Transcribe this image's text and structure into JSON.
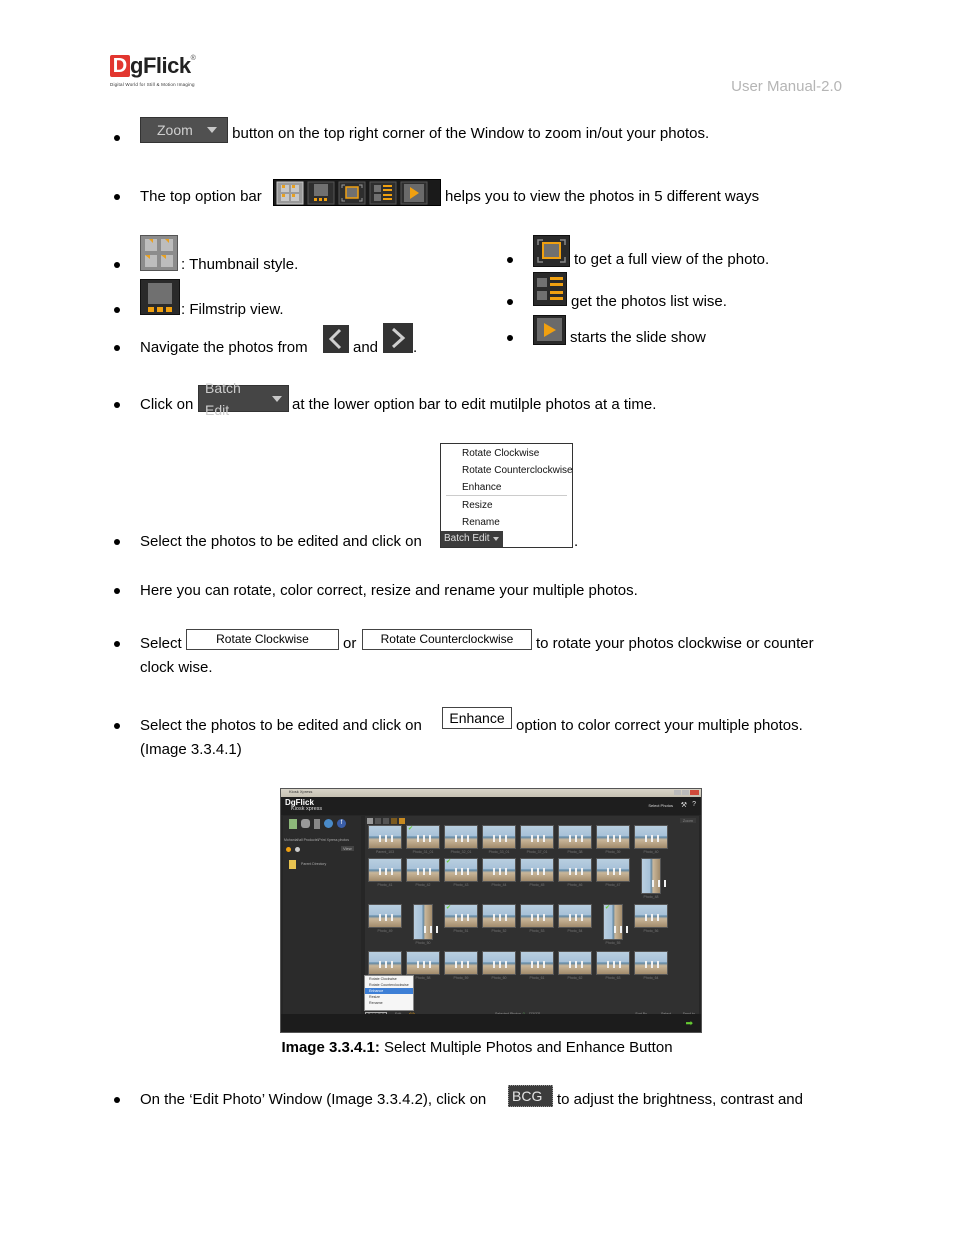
{
  "header": {
    "logo_letter": "D",
    "logo_text": "gFlick",
    "logo_registered": "®",
    "logo_tagline": "Digital World for Still & Motion Imaging",
    "doc_title": "User Manual-2.0"
  },
  "bullets": {
    "zoom": {
      "button_label": "Zoom",
      "text": "button on the top right corner of the Window to zoom in/out your photos."
    },
    "top_bar": {
      "prefix": "The top option bar",
      "suffix": "helps you to view the photos in 5 different ways"
    },
    "thumbnail": {
      "text": ": Thumbnail style."
    },
    "filmstrip": {
      "text": ": Filmstrip view."
    },
    "navigate": {
      "prefix": "Navigate the photos from",
      "middle": "and",
      "suffix": "."
    },
    "fullview": {
      "text": "to get a full view of the photo."
    },
    "listwise": {
      "text": "get the photos list wise."
    },
    "slideshow": {
      "text": "starts the slide show"
    },
    "batch_click": {
      "prefix": "Click on",
      "button_label": "Batch Edit",
      "suffix": "at the lower option bar to edit mutilple photos at a time."
    },
    "batch_select": {
      "prefix": "Select the photos to be edited and click on",
      "button_label": "Batch Edit",
      "suffix": "."
    },
    "batch_menu": [
      "Rotate Clockwise",
      "Rotate Counterclockwise",
      "Enhance",
      "Resize",
      "Rename"
    ],
    "here": {
      "text": "Here you can rotate, color correct, resize and rename your multiple photos."
    },
    "rotate": {
      "prefix": "Select",
      "btn1": "Rotate Clockwise",
      "middle": "or",
      "btn2": "Rotate Counterclockwise",
      "suffix": "to rotate your photos clockwise or counter",
      "line2": "clock wise."
    },
    "enhance": {
      "prefix": "Select the photos to be edited and click on",
      "button_label": "Enhance",
      "suffix": "option to color correct your multiple photos.",
      "line2": "(Image 3.3.4.1)"
    },
    "bcg": {
      "prefix": "On the ‘Edit Photo’ Window (Image 3.3.4.2), click on",
      "button_label": "BCG",
      "suffix": "to adjust the brightness, contrast and"
    }
  },
  "screenshot": {
    "window_title": "Kiosk Xpress",
    "app_brand": "DgFlick",
    "app_subtitle": "Kiosk xpress",
    "top_right_label": "Select Photos",
    "zoom_label": "Zoom",
    "path_text": "Mohanial\\all Products\\Print Xpress photos",
    "view_label": "View",
    "folder_label": "Parent Directory",
    "photo_labels": [
      [
        "Parent_103",
        "Photo_31_01",
        "Photo_32_01",
        "Photo_33_01",
        "Photo_37_01",
        "Photo_38",
        "Photo_39",
        "Photo_40"
      ],
      [
        "Photo_41",
        "Photo_42",
        "Photo_43",
        "Photo_44",
        "Photo_45",
        "Photo_46",
        "Photo_47",
        "Photo_48"
      ],
      [
        "Photo_49",
        "Photo_50",
        "Photo_51",
        "Photo_52",
        "Photo_53",
        "Photo_54",
        "Photo_55",
        "Photo_56"
      ],
      [
        "Photo_57",
        "Photo_58",
        "Photo_59",
        "Photo_60",
        "Photo_61",
        "Photo_62",
        "Photo_63",
        "Photo_64"
      ]
    ],
    "dropdown_items": [
      "Rotate Clockwise",
      "Rotate Counterclockwise",
      "Enhance",
      "Resize",
      "Rename"
    ],
    "dropdown_selected": "Enhance",
    "bottom": {
      "batch_edit": "Batch Edit",
      "edit": "Edit",
      "selected_label": "Selected Photos :",
      "selected_count": "1",
      "selected_total": "[23/32]",
      "sort_by": "Sort By",
      "select": "Select",
      "send_to": "Send to"
    }
  },
  "caption": {
    "label": "Image 3.3.4.1:",
    "text": " Select Multiple Photos and Enhance Button"
  }
}
